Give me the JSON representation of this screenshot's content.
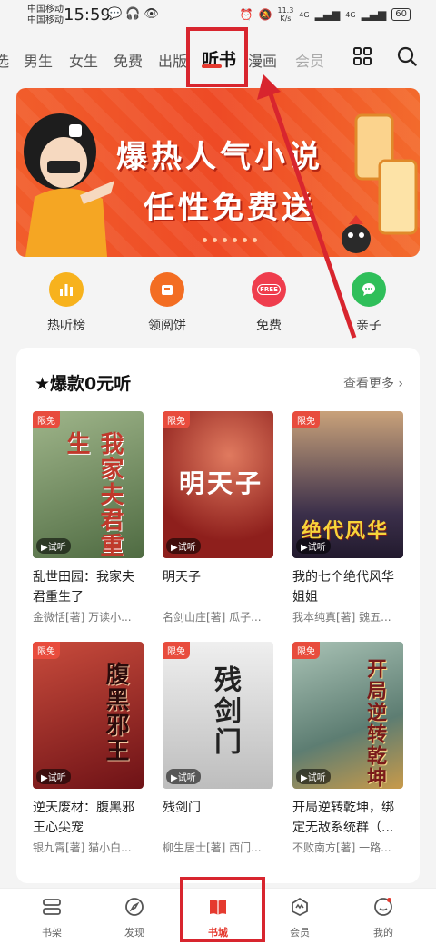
{
  "status_bar": {
    "carrier1": "中国移动",
    "carrier2": "中国移动",
    "time": "15:59",
    "speed": "11.3",
    "speed_unit": "K/s",
    "net1": "4G",
    "net2": "4G",
    "battery": "60"
  },
  "tabs": [
    "选",
    "男生",
    "女生",
    "免费",
    "出版",
    "听书",
    "漫画",
    "会员"
  ],
  "active_tab": "听书",
  "banner": {
    "line1": "爆热人气小说",
    "line2": "任性免费送"
  },
  "quick_entries": [
    {
      "label": "热听榜",
      "color": "#f7b21d"
    },
    {
      "label": "领阅饼",
      "color": "#f36d22"
    },
    {
      "label": "免费",
      "color": "#ef3d4d",
      "badge": "FREE"
    },
    {
      "label": "亲子",
      "color": "#2fbf5a"
    }
  ],
  "section": {
    "title": "★爆款0元听",
    "more": "查看更多 ›"
  },
  "badges": {
    "free": "限免",
    "trial": "▶试听"
  },
  "books": [
    {
      "name": "乱世田园：我家夫君重生了",
      "author": "金微恬[著] 万读小...",
      "cover_text": "我家夫君重生",
      "cover_bg": "#6f8a5a"
    },
    {
      "name": "明天子",
      "author": "名剑山庄[著] 瓜子...",
      "cover_text": "明天子",
      "cover_bg": "#b23a2c"
    },
    {
      "name": "我的七个绝代风华姐姐",
      "author": "我本纯真[著] 魏五...",
      "cover_text": "绝代风华",
      "cover_bg": "#3b2f4a"
    },
    {
      "name": "逆天废材：腹黑邪王心尖宠",
      "author": "银九霄[著] 猫小白...",
      "cover_text": "腹黑邪王",
      "cover_bg": "#8c1f24"
    },
    {
      "name": "残剑门",
      "author": "柳生居士[著] 西门...",
      "cover_text": "残剑门",
      "cover_bg": "#d9d9d9"
    },
    {
      "name": "开局逆转乾坤，绑定无敌系统群（...",
      "author": "不败南方[著] 一路...",
      "cover_text": "开局逆转乾坤",
      "cover_bg": "#6b8f8a"
    }
  ],
  "bottom_nav": [
    {
      "label": "书架"
    },
    {
      "label": "发现"
    },
    {
      "label": "书城"
    },
    {
      "label": "会员"
    },
    {
      "label": "我的"
    }
  ]
}
